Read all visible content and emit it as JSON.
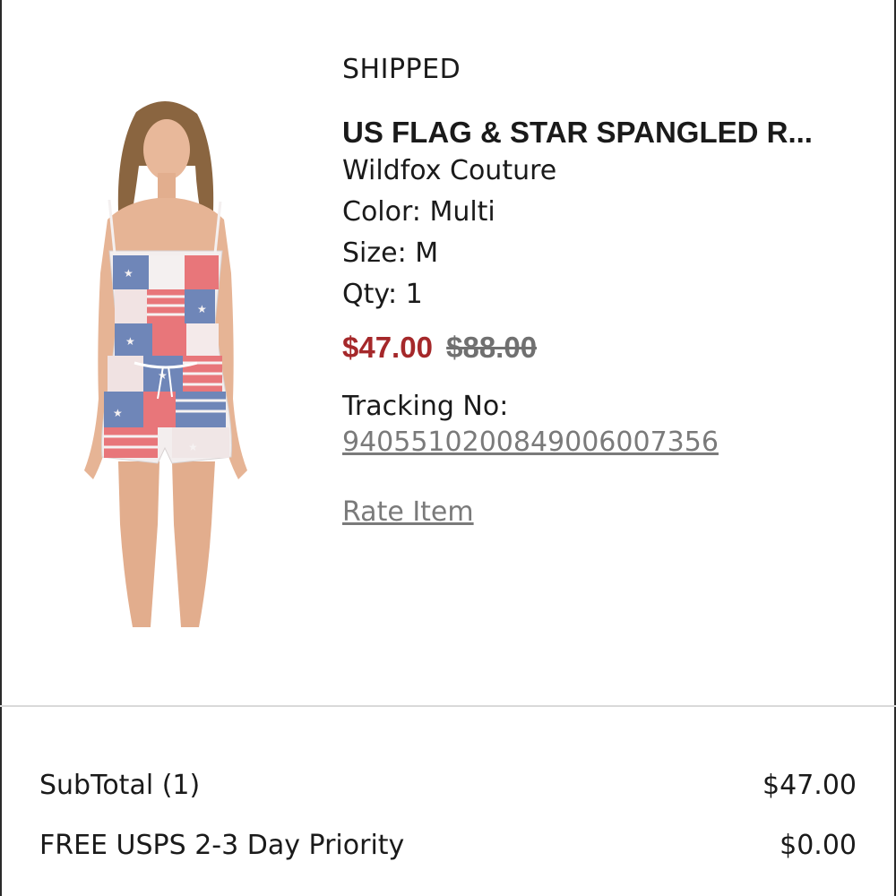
{
  "order_item": {
    "status": "SHIPPED",
    "product_name": "US FLAG & STAR SPANGLED R...",
    "brand": "Wildfox Couture",
    "color": "Color: Multi",
    "size": "Size: M",
    "quantity": "Qty: 1",
    "sale_price": "$47.00",
    "original_price": "$88.00",
    "tracking_label": "Tracking No:",
    "tracking_number": "9405510200849006007356",
    "rate_item_label": "Rate Item"
  },
  "summary": {
    "subtotal_label": "SubTotal (1)",
    "subtotal_value": "$47.00",
    "shipping_label": "FREE USPS 2-3 Day Priority",
    "shipping_value": "$0.00"
  },
  "colors": {
    "sale_price": "#a5282a",
    "muted_text": "#7a7a7a",
    "divider": "#d9d9d9",
    "flag_red": "#e8767a",
    "flag_blue": "#6f86b8"
  }
}
